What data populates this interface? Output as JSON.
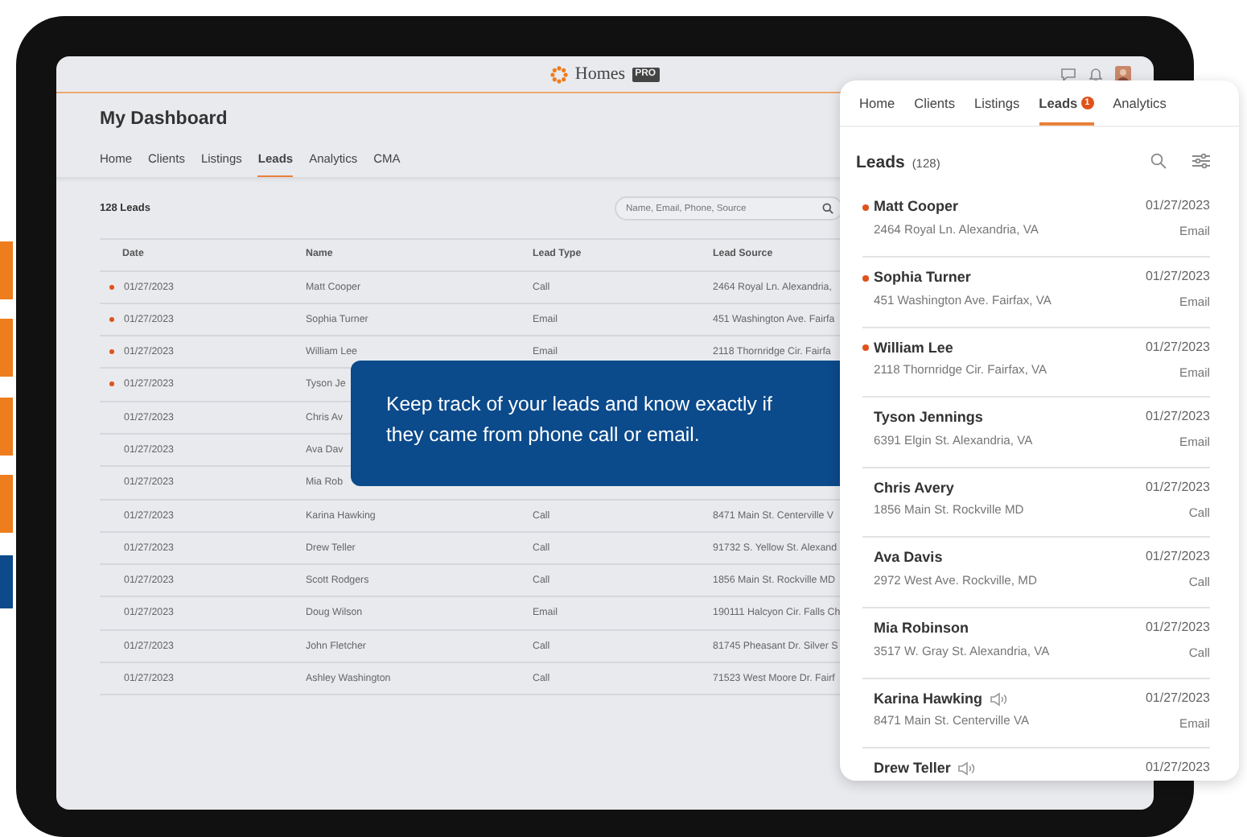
{
  "app": {
    "logo_text": "Homes",
    "logo_badge": "PRO"
  },
  "dashboard": {
    "title": "My Dashboard",
    "tabs": [
      {
        "label": "Home",
        "selected": false
      },
      {
        "label": "Clients",
        "selected": false
      },
      {
        "label": "Listings",
        "selected": false
      },
      {
        "label": "Leads",
        "selected": true
      },
      {
        "label": "Analytics",
        "selected": false
      },
      {
        "label": "CMA",
        "selected": false
      }
    ],
    "lead_count": "128 Leads",
    "search": {
      "placeholder": "Name, Email, Phone, Source"
    },
    "table": {
      "columns": [
        "Date",
        "Name",
        "Lead Type",
        "Lead Source"
      ],
      "rows": [
        {
          "unread": true,
          "cells": [
            "01/27/2023",
            "Matt Cooper",
            "Call",
            "2464 Royal Ln. Alexandria,"
          ]
        },
        {
          "unread": true,
          "cells": [
            "01/27/2023",
            "Sophia Turner",
            "Email",
            "451 Washington Ave. Fairfa"
          ]
        },
        {
          "unread": true,
          "cells": [
            "01/27/2023",
            "William Lee",
            "Email",
            "2118 Thornridge Cir. Fairfa"
          ]
        },
        {
          "unread": true,
          "cells": [
            "01/27/2023",
            "Tyson Je"
          ]
        },
        {
          "unread": false,
          "cells": [
            "01/27/2023",
            "Chris Av"
          ]
        },
        {
          "unread": false,
          "cells": [
            "01/27/2023",
            "Ava Dav"
          ]
        },
        {
          "unread": false,
          "cells": [
            "01/27/2023",
            "Mia Rob"
          ]
        },
        {
          "unread": false,
          "cells": [
            "01/27/2023",
            "Karina Hawking",
            "Call",
            "8471 Main St. Centerville V"
          ]
        },
        {
          "unread": false,
          "cells": [
            "01/27/2023",
            "Drew Teller",
            "Call",
            "91732 S. Yellow St. Alexand"
          ]
        },
        {
          "unread": false,
          "cells": [
            "01/27/2023",
            "Scott Rodgers",
            "Call",
            "1856 Main St. Rockville MD"
          ]
        },
        {
          "unread": false,
          "cells": [
            "01/27/2023",
            "Doug Wilson",
            "Email",
            "190111 Halcyon Cir. Falls Ch"
          ]
        },
        {
          "unread": false,
          "cells": [
            "01/27/2023",
            "John Fletcher",
            "Call",
            "81745 Pheasant Dr. Silver S"
          ]
        },
        {
          "unread": false,
          "cells": [
            "01/27/2023",
            "Ashley Washington",
            "Call",
            "71523 West Moore Dr. Fairf"
          ]
        }
      ]
    }
  },
  "callout": {
    "text": "Keep track of your leads and know exactly if they came from phone call or email."
  },
  "mobile": {
    "tabs": [
      {
        "label": "Home",
        "selected": false
      },
      {
        "label": "Clients",
        "selected": false
      },
      {
        "label": "Listings",
        "selected": false
      },
      {
        "label": "Leads",
        "selected": true,
        "badge": "1"
      },
      {
        "label": "Analytics",
        "selected": false
      }
    ],
    "title": "Leads",
    "count": "(128)",
    "leads": [
      {
        "name": "Matt Cooper",
        "address": "2464 Royal Ln. Alexandria, VA",
        "date": "01/27/2023",
        "type": "Email",
        "unread": true,
        "voicemail": false
      },
      {
        "name": "Sophia Turner",
        "address": "451 Washington Ave. Fairfax, VA",
        "date": "01/27/2023",
        "type": "Email",
        "unread": true,
        "voicemail": false
      },
      {
        "name": "William Lee",
        "address": "2118 Thornridge Cir. Fairfax, VA",
        "date": "01/27/2023",
        "type": "Email",
        "unread": true,
        "voicemail": false
      },
      {
        "name": "Tyson Jennings",
        "address": "6391 Elgin St. Alexandria, VA",
        "date": "01/27/2023",
        "type": "Email",
        "unread": false,
        "voicemail": false
      },
      {
        "name": "Chris Avery",
        "address": "1856 Main St. Rockville MD",
        "date": "01/27/2023",
        "type": "Call",
        "unread": false,
        "voicemail": false
      },
      {
        "name": "Ava Davis",
        "address": "2972 West Ave. Rockville, MD",
        "date": "01/27/2023",
        "type": "Call",
        "unread": false,
        "voicemail": false
      },
      {
        "name": "Mia Robinson",
        "address": "3517 W. Gray St. Alexandria, VA",
        "date": "01/27/2023",
        "type": "Call",
        "unread": false,
        "voicemail": false
      },
      {
        "name": "Karina Hawking",
        "address": "8471 Main St. Centerville VA",
        "date": "01/27/2023",
        "type": "Email",
        "unread": false,
        "voicemail": true
      },
      {
        "name": "Drew Teller",
        "date": "01/27/2023",
        "unread": false,
        "voicemail": true
      }
    ]
  }
}
